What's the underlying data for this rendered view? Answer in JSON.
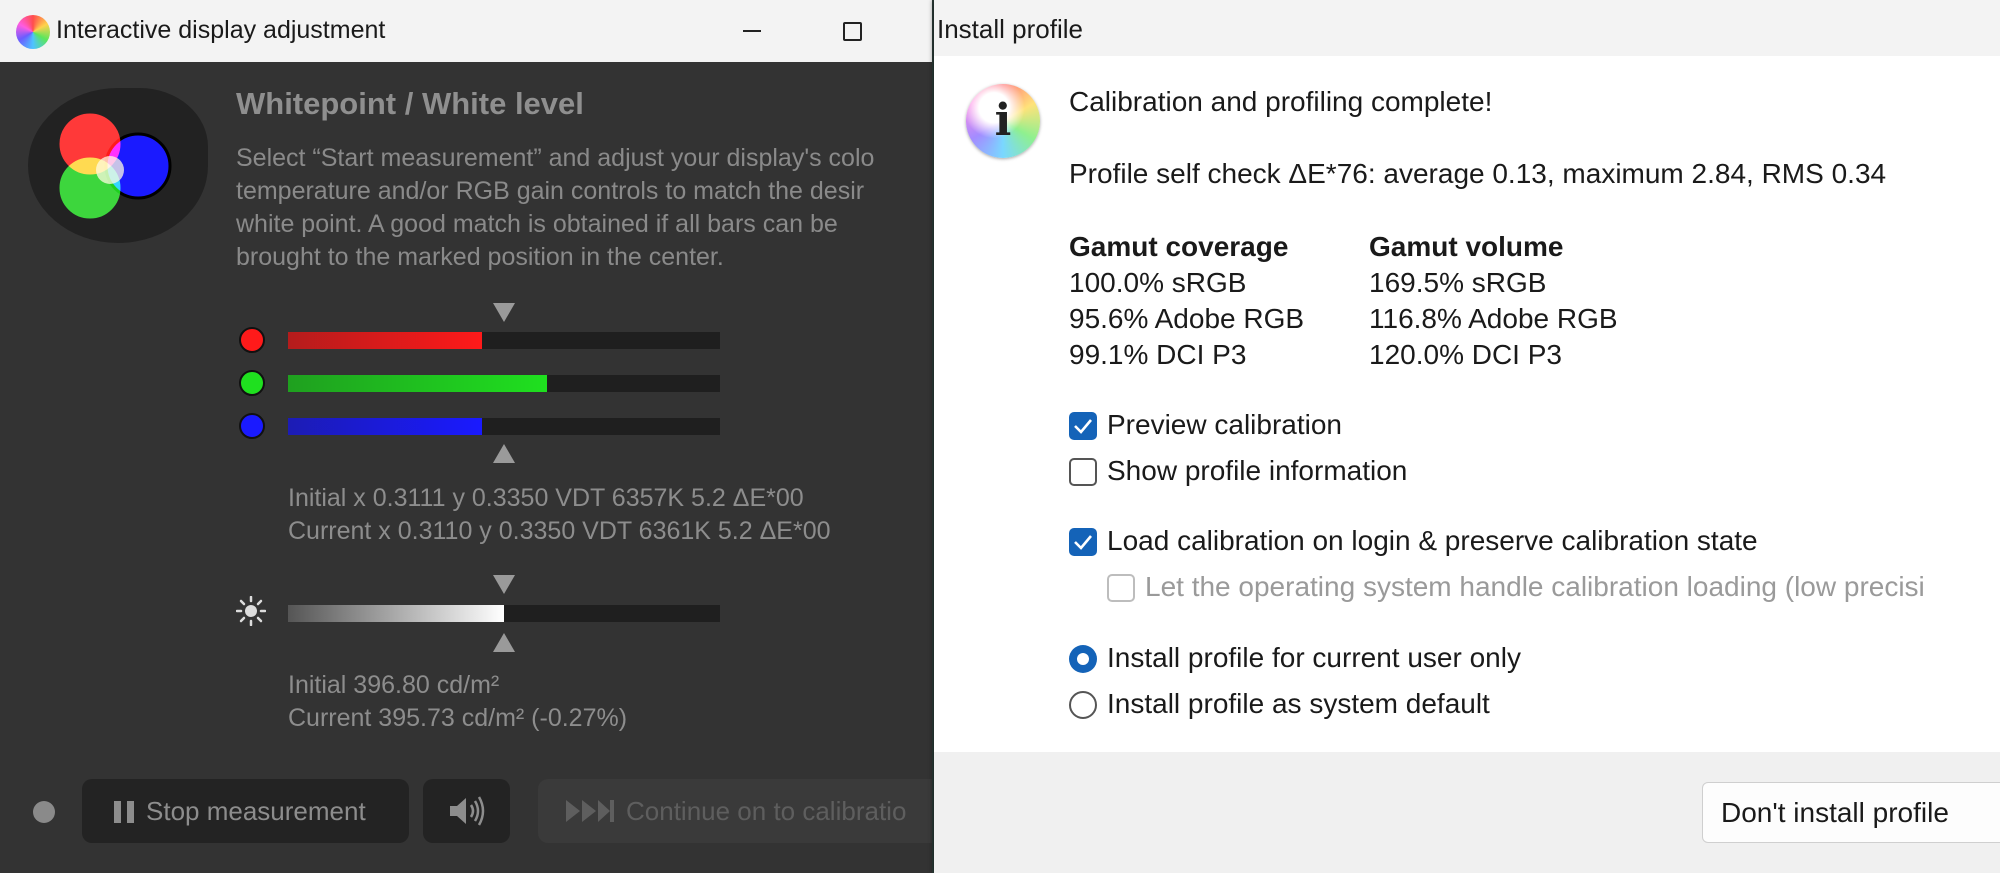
{
  "left_window": {
    "title": "Interactive display adjustment",
    "heading": "Whitepoint / White level",
    "instructions": "Select “Start measurement” and adjust your display's colo\ntemperature and/or RGB gain controls to match the desir\nwhite point. A good match is obtained if all bars can be\nbrought to the marked position in the center.",
    "bars": {
      "red": {
        "color": "#ff1a1a",
        "level": 0.45
      },
      "green": {
        "color": "#1fe01f",
        "level": 0.6
      },
      "blue": {
        "color": "#1a1aff",
        "level": 0.45
      }
    },
    "whitepoint": {
      "initial": "Initial x 0.3111 y 0.3350 VDT 6357K 5.2 ΔE*00",
      "current": "Current x 0.3110 y 0.3350 VDT 6361K 5.2 ΔE*00"
    },
    "luminance_bar_level": 0.5,
    "luminance": {
      "initial": "Initial 396.80 cd/m²",
      "current": "Current 395.73 cd/m² (-0.27%)"
    },
    "buttons": {
      "stop": "Stop measurement",
      "continue": "Continue on to calibratio"
    },
    "icons": [
      "app-icon",
      "rgb-logo-icon",
      "sun-icon",
      "pause-icon",
      "speaker-icon",
      "fast-forward-icon"
    ]
  },
  "right_window": {
    "title": "Install profile",
    "complete_message": "Calibration and profiling complete!",
    "self_check": "Profile self check ΔE*76: average 0.13, maximum 2.84, RMS 0.34",
    "gamut_coverage": {
      "header": "Gamut coverage",
      "lines": [
        "100.0% sRGB",
        "95.6% Adobe RGB",
        "99.1% DCI P3"
      ]
    },
    "gamut_volume": {
      "header": "Gamut volume",
      "lines": [
        "169.5% sRGB",
        "116.8% Adobe RGB",
        "120.0% DCI P3"
      ]
    },
    "options": {
      "preview_calibration": {
        "label": "Preview calibration",
        "checked": true
      },
      "show_profile_info": {
        "label": "Show profile information",
        "checked": false
      },
      "load_calibration": {
        "label": "Load calibration on login & preserve calibration state",
        "checked": true
      },
      "os_handle": {
        "label": "Let the operating system handle calibration loading (low precisi",
        "checked": false,
        "disabled": true
      }
    },
    "install_scope": {
      "current_user": {
        "label": "Install profile for current user only",
        "selected": true
      },
      "system_default": {
        "label": "Install profile as system default",
        "selected": false
      }
    },
    "buttons": {
      "dont_install": "Don't install profile"
    },
    "accent_color": "#1463b8"
  }
}
